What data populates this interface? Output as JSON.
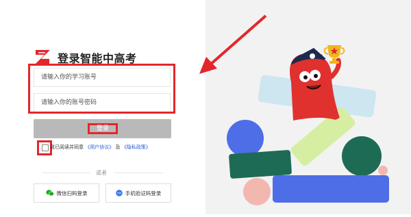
{
  "header": {
    "title": "登录智能中高考"
  },
  "form": {
    "account_placeholder": "请输入你的学习账号",
    "password_placeholder": "请输入你的账号密码",
    "login_label": "登录"
  },
  "agreement": {
    "prefix": "我已阅读并同意",
    "user_agreement": "《用户协议》",
    "and": "及",
    "privacy_policy": "《隐私政策》"
  },
  "divider": {
    "text": "或者"
  },
  "alt_login": {
    "wechat_label": "微信扫码登录",
    "phone_label": "手机验证码登录"
  },
  "colors": {
    "highlight": "#e3262b",
    "link": "#2a5bd7",
    "wechat": "#1aad19",
    "phone": "#3a7bf0"
  }
}
